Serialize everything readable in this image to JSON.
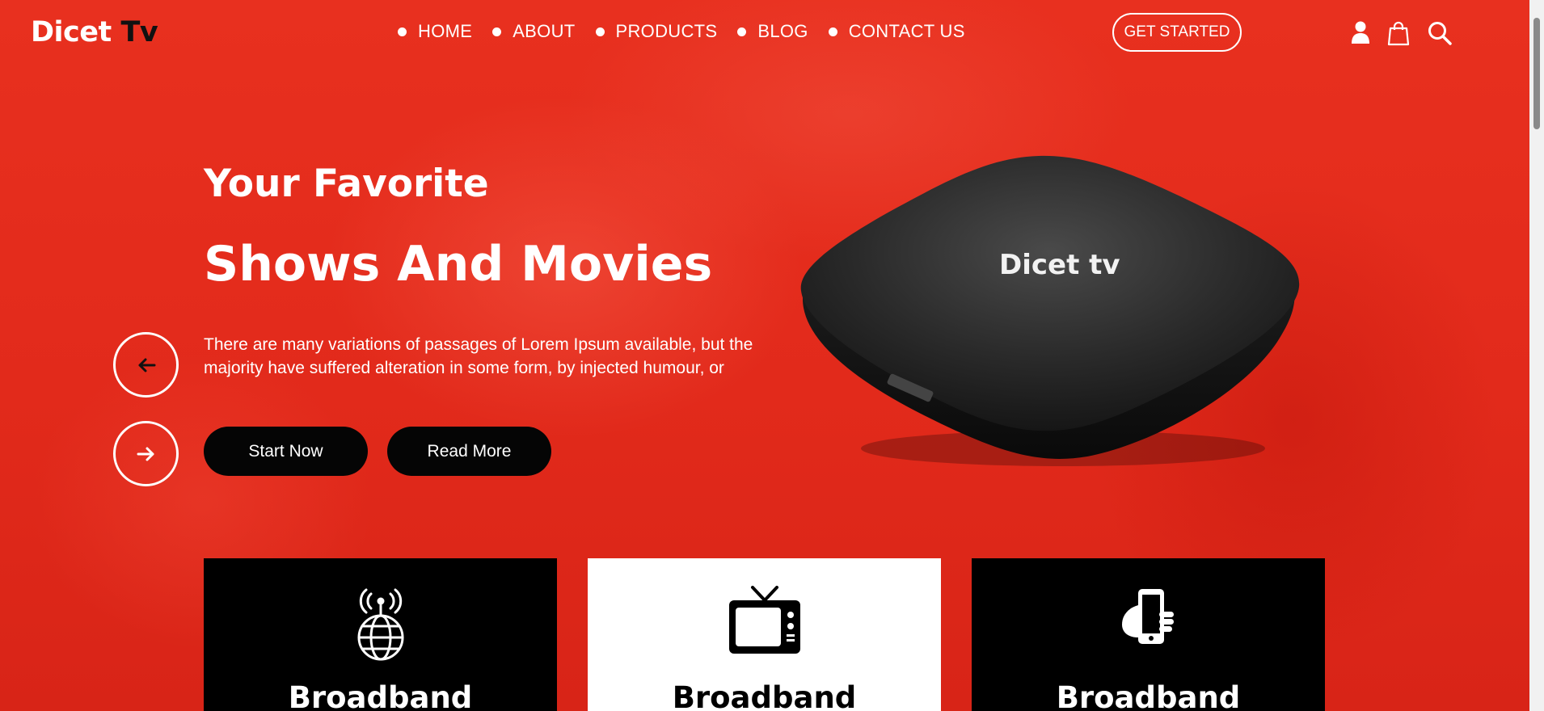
{
  "brand": {
    "logo_part1": "Dicet ",
    "logo_part2": "Tv"
  },
  "nav": {
    "items": [
      {
        "label": "HOME"
      },
      {
        "label": "ABOUT"
      },
      {
        "label": "PRODUCTS"
      },
      {
        "label": "BLOG"
      },
      {
        "label": "CONTACT US"
      }
    ]
  },
  "header": {
    "cta_label": "GET STARTED",
    "icons": [
      "user-icon",
      "shopping-bag-icon",
      "search-icon"
    ]
  },
  "hero": {
    "title_line1": "Your Favorite",
    "title_line2": "Shows And Movies",
    "description": "There are many variations of passages of Lorem Ipsum available, but the majority have suffered alteration in some form, by injected humour, or",
    "primary_button": "Start Now",
    "secondary_button": "Read More",
    "prev_icon": "arrow-left-icon",
    "next_icon": "arrow-right-icon",
    "device_label": "Dicet tv"
  },
  "cards": [
    {
      "title": "Broadband",
      "icon": "antenna-globe-icon",
      "theme": "dark"
    },
    {
      "title": "Broadband",
      "icon": "tv-icon",
      "theme": "light"
    },
    {
      "title": "Broadband",
      "icon": "hand-phone-icon",
      "theme": "dark"
    }
  ],
  "colors": {
    "accent": "#e3291c",
    "dark": "#000000",
    "light": "#ffffff"
  }
}
